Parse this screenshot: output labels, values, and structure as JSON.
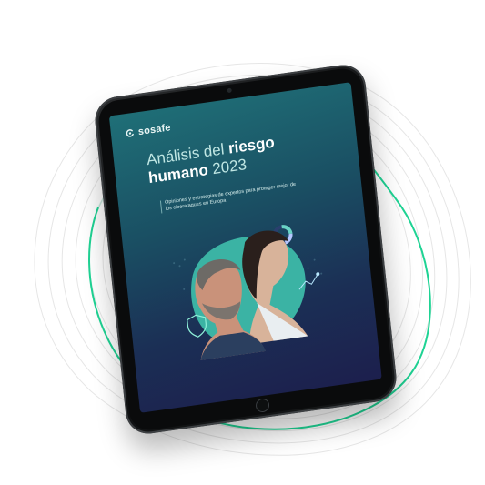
{
  "cover": {
    "brand": "sosafe",
    "title_line1_light": "Análisis del ",
    "title_line1_strong": "riesgo",
    "title_line2_strong": "humano",
    "title_line2_light": " 2023",
    "subtitle": "Opiniones y estrategias de expertos para proteger mejor de los ciberataques en Europa"
  },
  "colors": {
    "accent_green": "#1fd394",
    "screen_top": "#1f6f77",
    "screen_bottom": "#1c1f4d",
    "tablet_frame": "#0b0c0d"
  },
  "icons": [
    "sosafe-logo-icon",
    "shield-icon",
    "chart-line-icon",
    "donut-chart-icon",
    "home-button-icon"
  ]
}
